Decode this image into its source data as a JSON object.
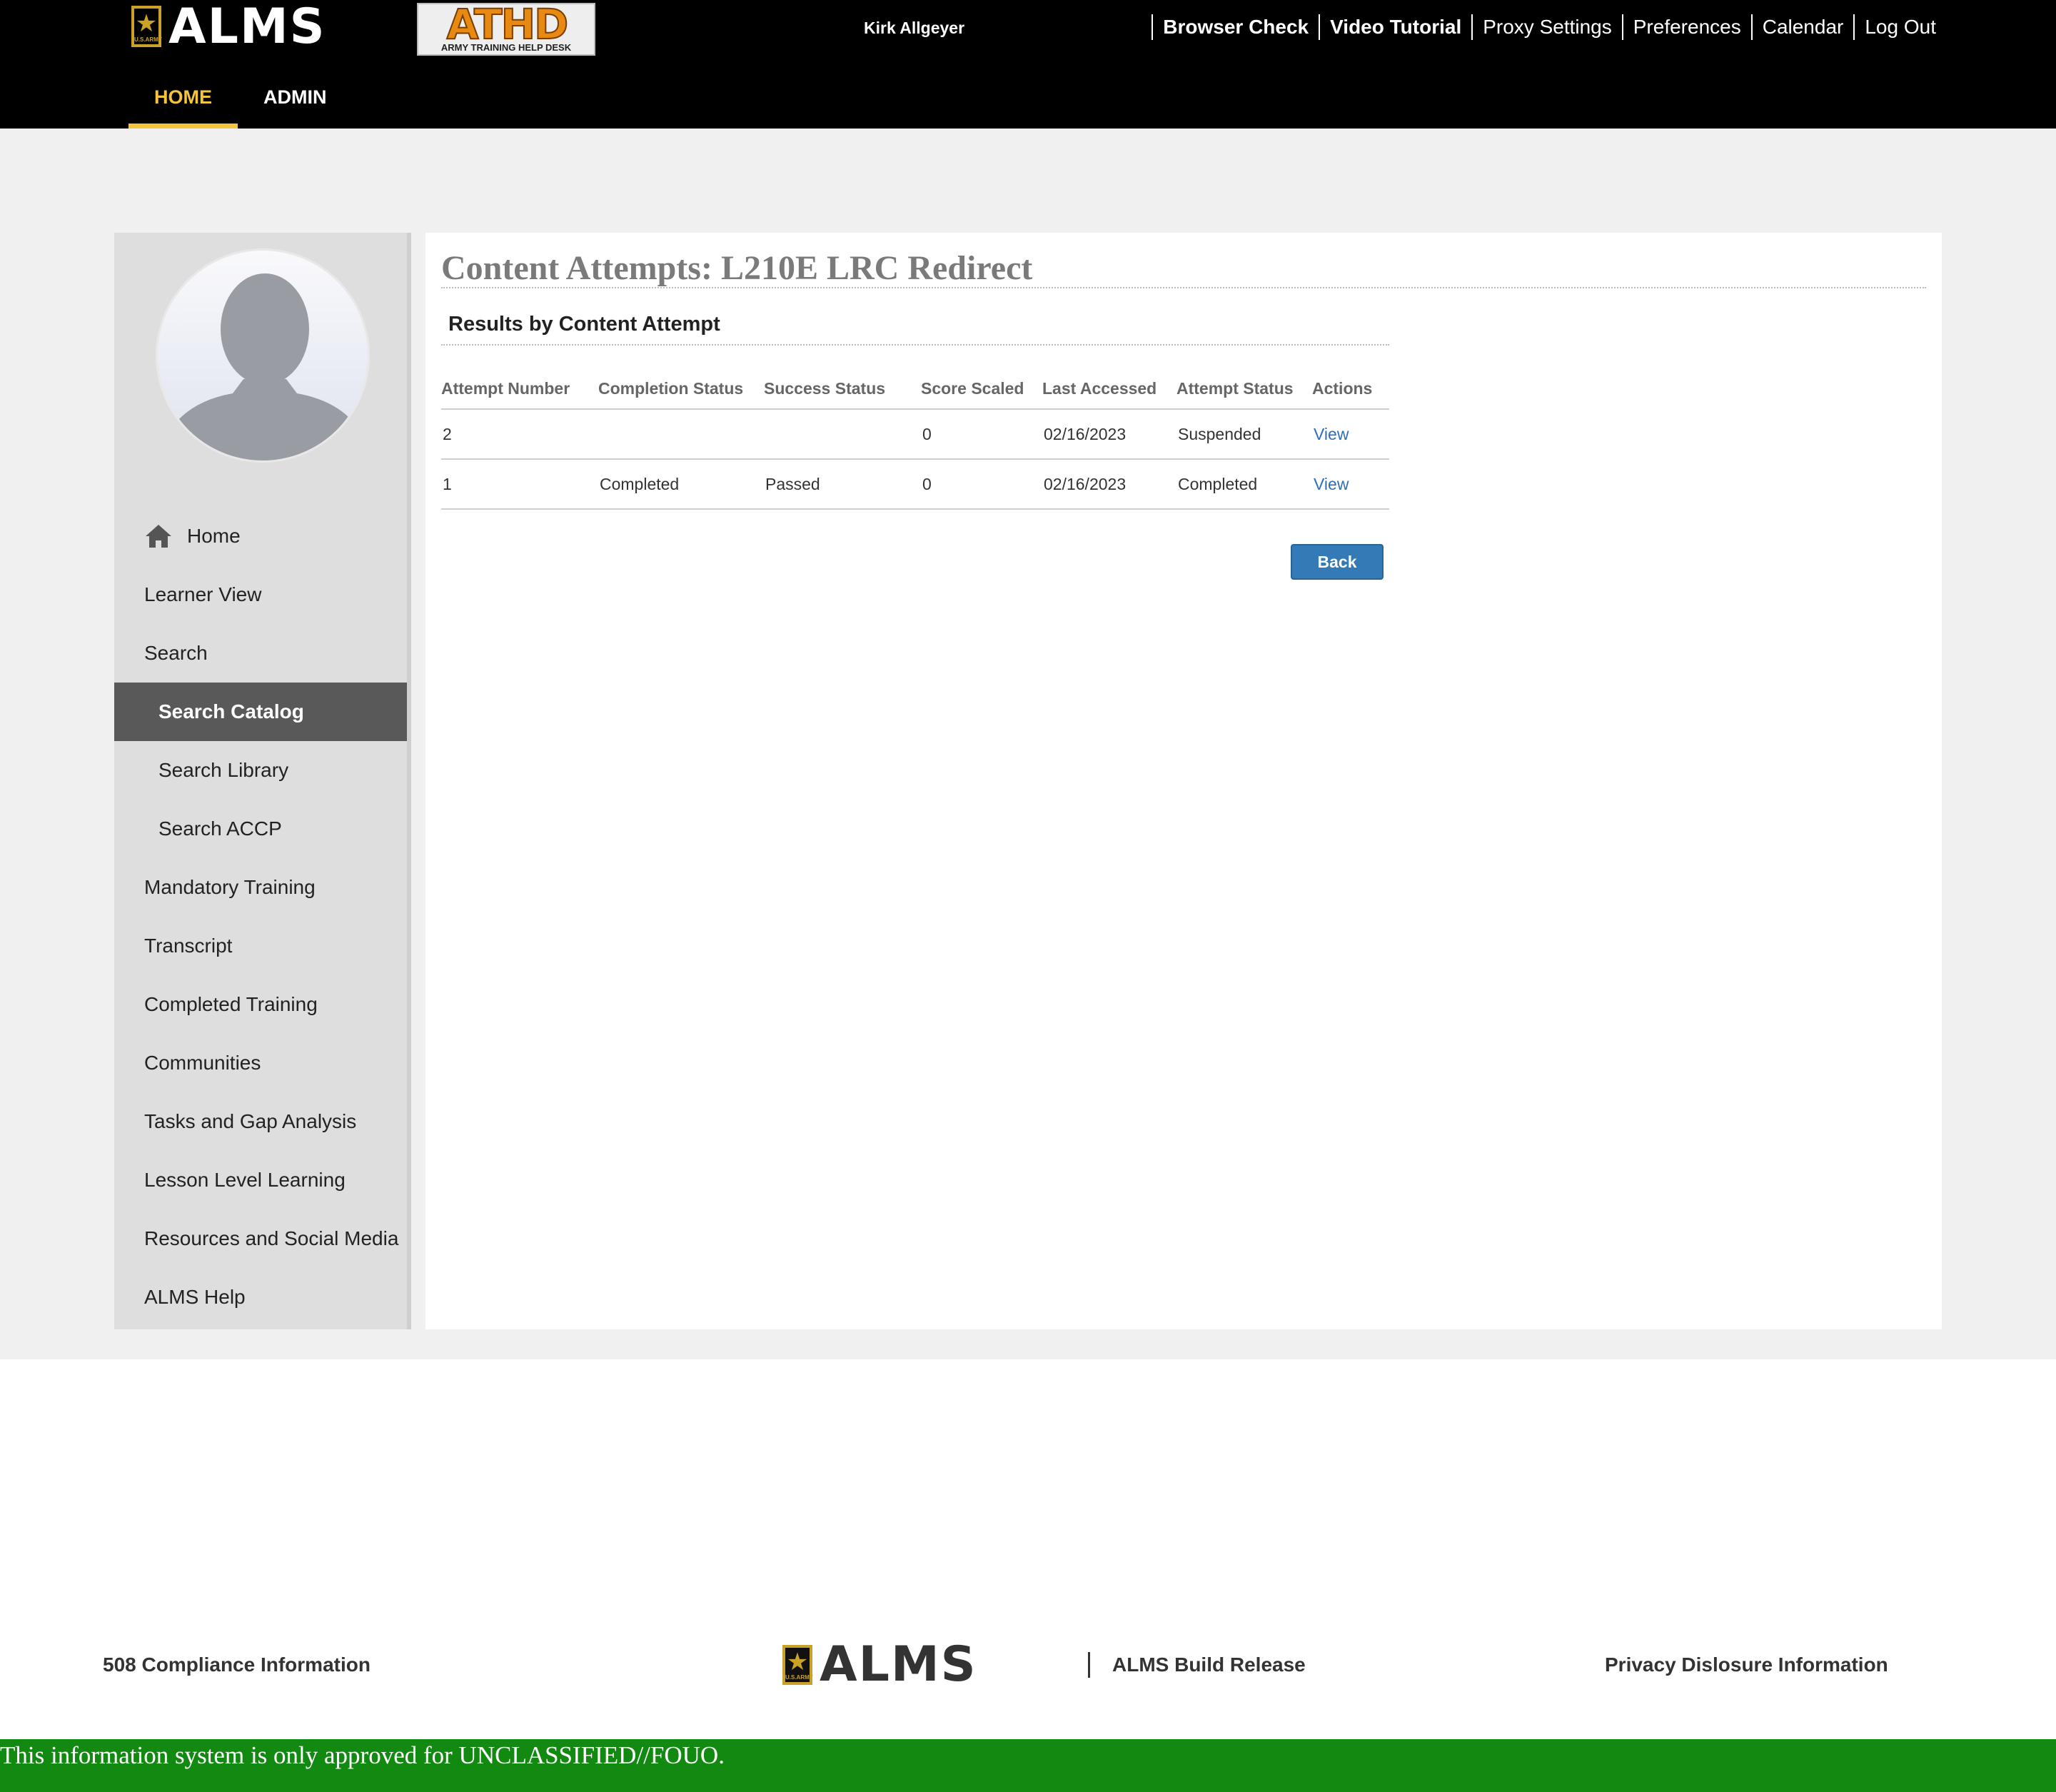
{
  "header": {
    "app_name": "ALMS",
    "logo_usa": "U.S.ARMY",
    "athd_big": "ATHD",
    "athd_small": "ARMY TRAINING HELP DESK",
    "username": "Kirk Allgeyer",
    "links": [
      "Browser Check",
      "Video Tutorial",
      "Proxy Settings",
      "Preferences",
      "Calendar",
      "Log Out"
    ],
    "tabs": [
      "HOME",
      "ADMIN"
    ],
    "active_tab": "HOME",
    "accent_color": "#f2c53d"
  },
  "sidebar": {
    "items": [
      {
        "label": "Home",
        "icon": "home-icon"
      },
      {
        "label": "Learner View"
      },
      {
        "label": "Search"
      },
      {
        "label": "Search Catalog",
        "active": true
      },
      {
        "label": "Search Library"
      },
      {
        "label": "Search ACCP"
      },
      {
        "label": "Mandatory Training"
      },
      {
        "label": "Transcript"
      },
      {
        "label": "Completed Training"
      },
      {
        "label": "Communities"
      },
      {
        "label": "Tasks and Gap Analysis"
      },
      {
        "label": "Lesson Level Learning"
      },
      {
        "label": "Resources and Social Media"
      },
      {
        "label": "ALMS Help"
      }
    ]
  },
  "main": {
    "title": "Content Attempts: L210E LRC Redirect",
    "section_title": "Results by Content Attempt",
    "columns": [
      "Attempt Number",
      "Completion Status",
      "Success Status",
      "Score Scaled",
      "Last Accessed",
      "Attempt Status",
      "Actions"
    ],
    "rows": [
      {
        "attempt": "2",
        "completion": "",
        "success": "",
        "score": "0",
        "last_accessed": "02/16/2023",
        "status": "Suspended",
        "action": "View"
      },
      {
        "attempt": "1",
        "completion": "Completed",
        "success": "Passed",
        "score": "0",
        "last_accessed": "02/16/2023",
        "status": "Completed",
        "action": "View"
      }
    ],
    "back_label": "Back"
  },
  "footer": {
    "compliance": "508 Compliance Information",
    "logo_text": "ALMS",
    "build": "ALMS Build Release",
    "privacy": "Privacy Dislosure Information",
    "classification": "This information system is only approved for UNCLASSIFIED//FOUO.",
    "classification_color": "#128a12"
  }
}
